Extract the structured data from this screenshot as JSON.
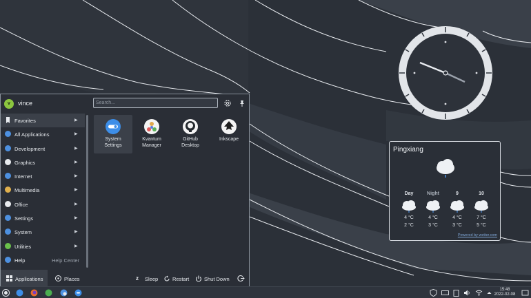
{
  "user": {
    "name": "vince",
    "initial": "v"
  },
  "search": {
    "placeholder": "Search..."
  },
  "categories": [
    {
      "label": "Favorites",
      "color": "#e8ebef",
      "active": true
    },
    {
      "label": "All Applications",
      "color": "#4d90e0"
    },
    {
      "label": "Development",
      "color": "#4d90e0"
    },
    {
      "label": "Graphics",
      "color": "#e8ebef"
    },
    {
      "label": "Internet",
      "color": "#4d90e0"
    },
    {
      "label": "Multimedia",
      "color": "#e0b04d"
    },
    {
      "label": "Office",
      "color": "#e8ebef"
    },
    {
      "label": "Settings",
      "color": "#4d90e0"
    },
    {
      "label": "System",
      "color": "#4d90e0"
    },
    {
      "label": "Utilities",
      "color": "#6ac04a"
    },
    {
      "label": "Help",
      "color": "#4d90e0",
      "extra": "Help Center"
    }
  ],
  "apps": [
    {
      "line1": "System",
      "line2": "Settings",
      "icon": "system-settings-icon"
    },
    {
      "line1": "Kvantum",
      "line2": "Manager",
      "icon": "kvantum-icon"
    },
    {
      "line1": "GitHub",
      "line2": "Desktop",
      "icon": "github-icon"
    },
    {
      "line1": "Inkscape",
      "line2": "",
      "icon": "inkscape-icon"
    }
  ],
  "footer": {
    "tabs": {
      "applications": "Applications",
      "places": "Places"
    },
    "power": {
      "sleep": "Sleep",
      "restart": "Restart",
      "shutdown": "Shut Down"
    }
  },
  "weather": {
    "city": "Pingxiang",
    "columns": [
      {
        "label": "Day",
        "high": "4 °C",
        "low": "2 °C"
      },
      {
        "label": "Night",
        "high": "4 °C",
        "low": "3 °C"
      },
      {
        "label": "9",
        "high": "4 °C",
        "low": "3 °C"
      },
      {
        "label": "10",
        "high": "7 °C",
        "low": "5 °C"
      }
    ],
    "powered": "Powered by wetter.com"
  },
  "taskbar": {
    "time": "15:48",
    "date": "2022-02-08"
  },
  "colors": {
    "accent": "#3d8ee8",
    "panel": "#2a2e36",
    "wallpaper": "#2b3038"
  }
}
